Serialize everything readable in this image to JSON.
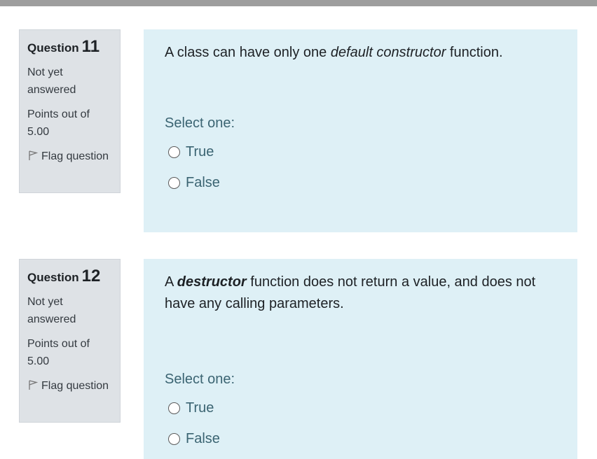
{
  "questions": [
    {
      "label": "Question",
      "number": "11",
      "state": "Not yet answered",
      "grade": "Points out of 5.00",
      "flag": "Flag question",
      "text_parts": {
        "pre": "A class can have only one ",
        "emphasis": "default constructor",
        "post": " function."
      },
      "prompt": "Select one:",
      "options": [
        "True",
        "False"
      ]
    },
    {
      "label": "Question",
      "number": "12",
      "state": "Not yet answered",
      "grade": "Points out of 5.00",
      "flag": "Flag question",
      "text_parts": {
        "pre": "A ",
        "emphasis": "destructor",
        "post": " function does not return a value, and does not have any calling parameters."
      },
      "prompt": "Select one:",
      "options": [
        "True",
        "False"
      ]
    }
  ]
}
